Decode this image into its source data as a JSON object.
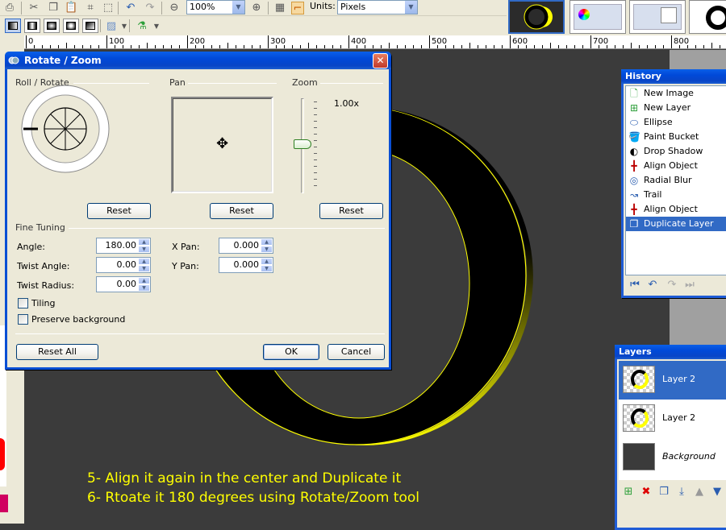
{
  "toolbar": {
    "zoom_value": "100%",
    "units_label": "Units:",
    "units_value": "Pixels"
  },
  "ruler": {
    "labels": [
      "0",
      "100",
      "200",
      "300",
      "400",
      "500",
      "600",
      "700",
      "800"
    ]
  },
  "dialog": {
    "title": "Rotate / Zoom",
    "sections": {
      "roll_rotate": "Roll / Rotate",
      "pan": "Pan",
      "zoom": "Zoom",
      "fine_tuning": "Fine Tuning"
    },
    "zoom_value": "1.00x",
    "reset_label": "Reset",
    "fields": {
      "angle_label": "Angle:",
      "angle_value": "180.00",
      "twist_angle_label": "Twist Angle:",
      "twist_angle_value": "0.00",
      "twist_radius_label": "Twist Radius:",
      "twist_radius_value": "0.00",
      "xpan_label": "X Pan:",
      "xpan_value": "0.000",
      "ypan_label": "Y Pan:",
      "ypan_value": "0.000"
    },
    "tiling_label": "Tiling",
    "preserve_label": "Preserve background",
    "reset_all_label": "Reset All",
    "ok_label": "OK",
    "cancel_label": "Cancel"
  },
  "history": {
    "title": "History",
    "items": [
      {
        "label": "New Image",
        "icon": "new-image-icon"
      },
      {
        "label": "New Layer",
        "icon": "new-layer-icon"
      },
      {
        "label": "Ellipse",
        "icon": "ellipse-icon"
      },
      {
        "label": "Paint Bucket",
        "icon": "paint-bucket-icon"
      },
      {
        "label": "Drop Shadow",
        "icon": "drop-shadow-icon"
      },
      {
        "label": "Align Object",
        "icon": "align-object-icon"
      },
      {
        "label": "Radial Blur",
        "icon": "radial-blur-icon"
      },
      {
        "label": "Trail",
        "icon": "trail-icon"
      },
      {
        "label": "Align Object",
        "icon": "align-object-icon"
      },
      {
        "label": "Duplicate Layer",
        "icon": "duplicate-layer-icon",
        "selected": true
      }
    ]
  },
  "layers": {
    "title": "Layers",
    "rows": [
      {
        "name": "Layer 2",
        "selected": true
      },
      {
        "name": "Layer 2",
        "selected": false
      },
      {
        "name": "Background",
        "selected": false
      }
    ]
  },
  "captions": {
    "line1": "5- Align it again in the center and Duplicate it",
    "line2": "6- Rtoate it 180 degrees using Rotate/Zoom tool"
  },
  "colors": {
    "caption": "#ffff00",
    "selection": "#316ac5",
    "canvas": "#3b3b3b",
    "titlebar": "#0a5fe8"
  }
}
